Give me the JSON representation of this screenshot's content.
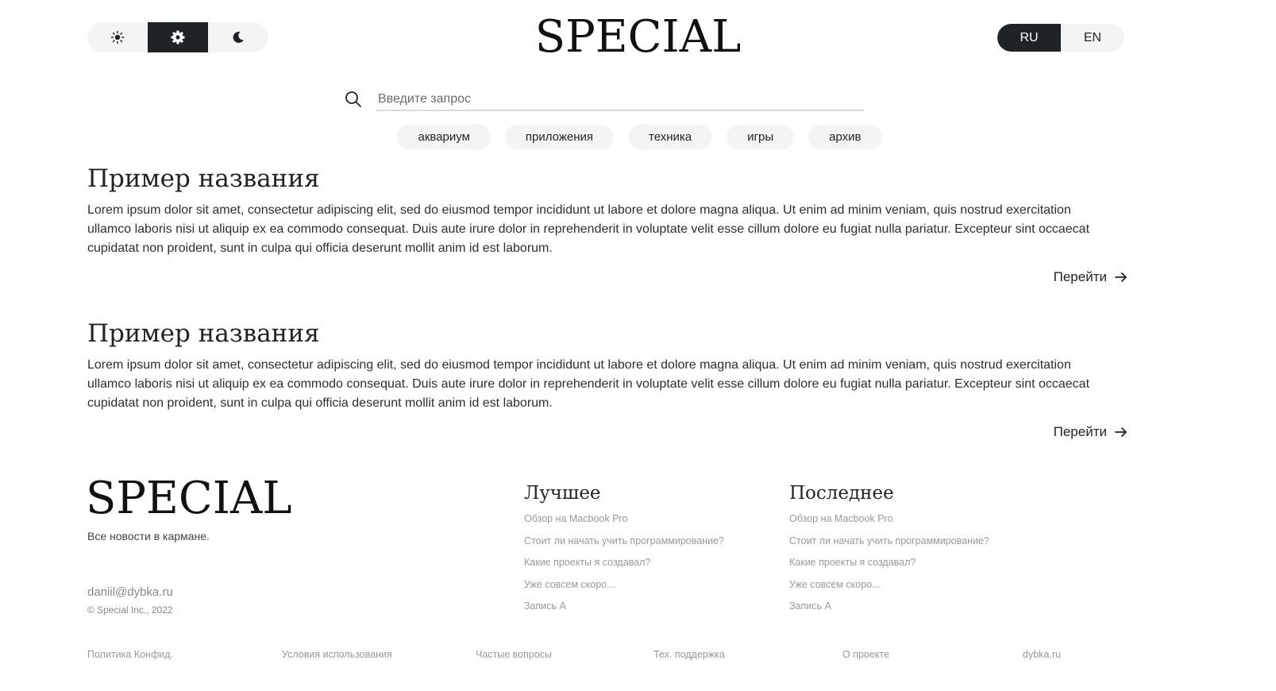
{
  "header": {
    "theme_options": [
      {
        "name": "light-theme-button",
        "icon": "sun-icon"
      },
      {
        "name": "system-theme-button",
        "icon": "gear-icon",
        "active": true
      },
      {
        "name": "dark-theme-button",
        "icon": "moon-icon"
      }
    ],
    "logo": "SPECIAL",
    "languages": [
      {
        "label": "RU",
        "active": true
      },
      {
        "label": "EN",
        "active": false
      }
    ]
  },
  "search": {
    "placeholder": "Введите запрос",
    "value": "",
    "tags": [
      "аквариум",
      "приложения",
      "техника",
      "игры",
      "архив"
    ]
  },
  "articles": [
    {
      "title": "Пример названия",
      "text": "Lorem ipsum dolor sit amet, consectetur adipiscing elit, sed do eiusmod tempor incididunt ut labore et dolore magna aliqua. Ut enim ad minim veniam, quis nostrud exercitation ullamco laboris nisi ut aliquip ex ea commodo consequat. Duis aute irure dolor in reprehenderit in voluptate velit esse cillum dolore eu fugiat nulla pariatur. Excepteur sint occaecat cupidatat non proident, sunt in culpa qui officia deserunt mollit anim id est laborum.",
      "link_label": "Перейти"
    },
    {
      "title": "Пример названия",
      "text": "Lorem ipsum dolor sit amet, consectetur adipiscing elit, sed do eiusmod tempor incididunt ut labore et dolore magna aliqua. Ut enim ad minim veniam, quis nostrud exercitation ullamco laboris nisi ut aliquip ex ea commodo consequat. Duis aute irure dolor in reprehenderit in voluptate velit esse cillum dolore eu fugiat nulla pariatur. Excepteur sint occaecat cupidatat non proident, sunt in culpa qui officia deserunt mollit anim id est laborum.",
      "link_label": "Перейти"
    }
  ],
  "footer": {
    "logo": "SPECIAL",
    "tagline": "Все новости в кармане.",
    "email": "daniil@dybka.ru",
    "copyright": "© Special Inc., 2022",
    "best": {
      "title": "Лучшее",
      "items": [
        "Обзор на Macbook Pro",
        "Стоит ли начать учить программирование?",
        "Какие проекты я создавал?",
        "Уже совсем скоро...",
        "Запись А"
      ]
    },
    "latest": {
      "title": "Последнее",
      "items": [
        "Обзор на Macbook Pro",
        "Стоит ли начать учить программирование?",
        "Какие проекты я создавал?",
        "Уже совсем скоро...",
        "Запись А"
      ]
    },
    "bottom_links": [
      "Политика Конфид.",
      "Условия использования",
      "Частые вопросы",
      "Тех. поддержка",
      "О проекте",
      "dybka.ru"
    ]
  },
  "colors": {
    "dark": "#1f2328",
    "pill_bg": "#f4f4f5",
    "muted_text": "#999999"
  }
}
